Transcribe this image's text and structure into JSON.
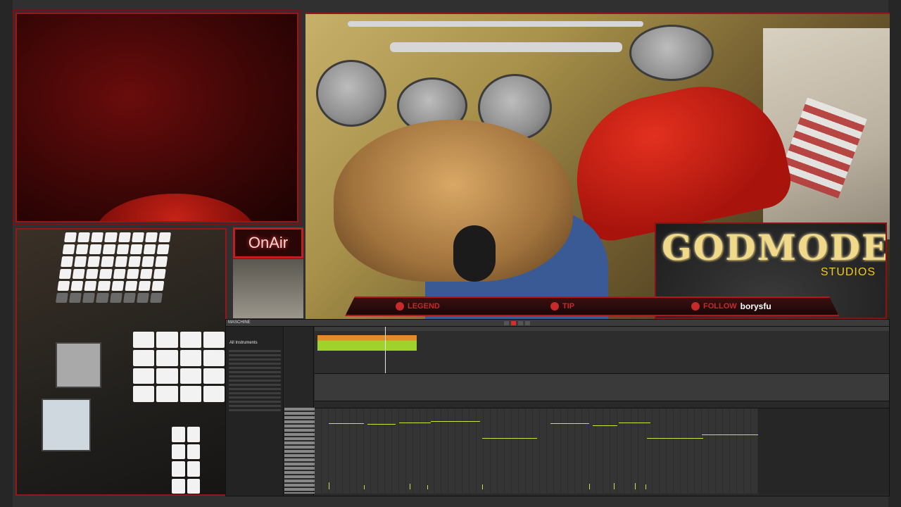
{
  "overlay": {
    "onair_label": "OnAir",
    "logo_title": "GODMODE",
    "logo_subtitle": "STUDIOS",
    "alerts": {
      "legend_label": "LEGEND",
      "tip_label": "TIP",
      "follow_label": "FOLLOW",
      "follow_name": "borysfu"
    }
  },
  "daw": {
    "app_title": "MASCHINE",
    "browser_header": "All Instruments"
  },
  "colors": {
    "frame_red": "#b3161b",
    "note_green": "#c6e63c",
    "logo_gold": "#f0d989",
    "studios_yellow": "#f3c91b"
  }
}
